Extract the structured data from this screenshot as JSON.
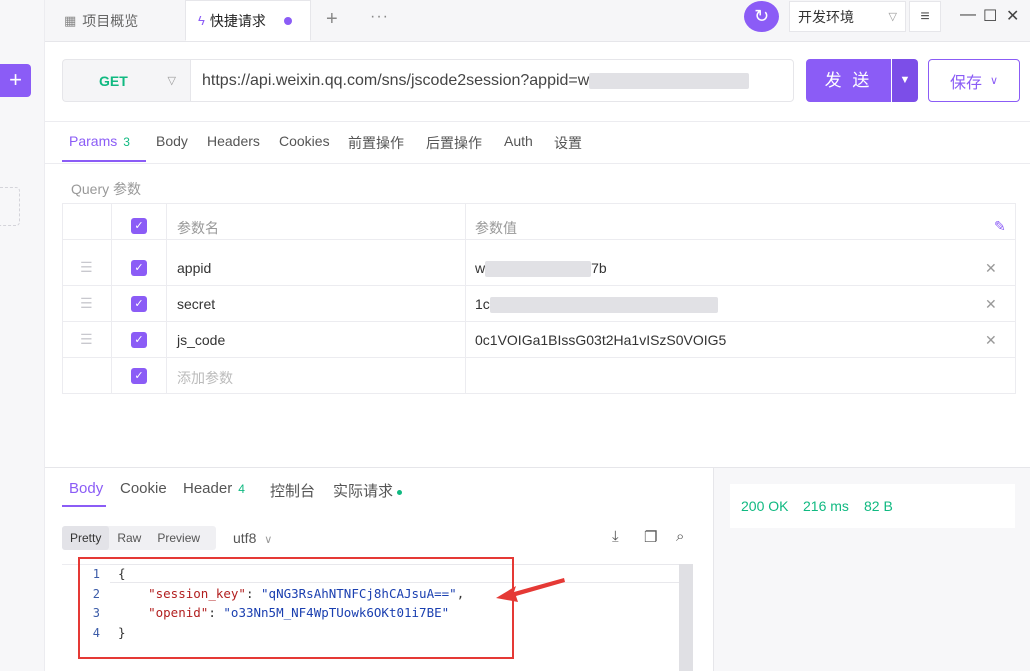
{
  "tabs": {
    "overview": "项目概览",
    "quick": "快捷请求",
    "add": "+",
    "more": "···"
  },
  "env": {
    "selected": "开发环境"
  },
  "request": {
    "method": "GET",
    "url_visible": "https://api.weixin.qq.com/sns/jscode2session?appid=w",
    "send_label": "发 送",
    "save_label": "保存"
  },
  "req_tabs": [
    {
      "label": "Params",
      "count": "3"
    },
    {
      "label": "Body"
    },
    {
      "label": "Headers"
    },
    {
      "label": "Cookies"
    },
    {
      "label": "前置操作"
    },
    {
      "label": "后置操作"
    },
    {
      "label": "Auth"
    },
    {
      "label": "设置"
    }
  ],
  "query": {
    "label": "Query 参数",
    "col_name": "参数名",
    "col_value": "参数值",
    "rows": [
      {
        "name": "appid",
        "value_start": "w",
        "value_end": "7b"
      },
      {
        "name": "secret",
        "value_start": "1c",
        "value_end": ""
      },
      {
        "name": "js_code",
        "value_start": "0c1VOIGa1BIssG03t2Ha1vISzS0VOIG5",
        "value_end": ""
      }
    ],
    "add_placeholder": "添加参数"
  },
  "resp_tabs": [
    {
      "label": "Body"
    },
    {
      "label": "Cookie"
    },
    {
      "label": "Header",
      "count": "4"
    },
    {
      "label": "控制台"
    },
    {
      "label": "实际请求"
    }
  ],
  "format": {
    "modes": [
      "Pretty",
      "Raw",
      "Preview"
    ],
    "active": "Pretty",
    "encoding": "utf8"
  },
  "status": {
    "code": "200 OK",
    "time": "216 ms",
    "size": "82 B"
  },
  "response_lines": [
    {
      "n": "1",
      "text": "{"
    },
    {
      "n": "2",
      "key": "\"session_key\"",
      "val": "\"qNG3RsAhNTNFCj8hCAJsuA==\"",
      "tail": ","
    },
    {
      "n": "3",
      "key": "\"openid\"",
      "val": "\"o33Nn5M_NF4WpTUowk6OKt01i7BE\"",
      "tail": ""
    },
    {
      "n": "4",
      "text": "}"
    }
  ],
  "colors": {
    "accent": "#8b5cf6",
    "success": "#10b981",
    "annotation": "#e53935"
  }
}
